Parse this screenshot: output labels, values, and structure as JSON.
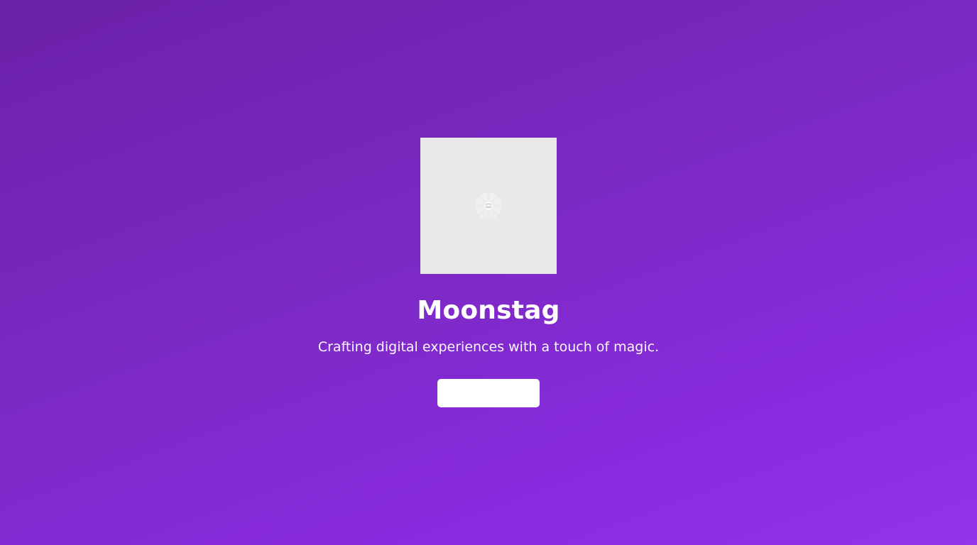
{
  "brand": {
    "name": "Moonstag",
    "tagline": "Crafting digital experiences with a touch of magic."
  },
  "hero_image": {
    "icon": "image-placeholder-icon"
  },
  "cta": {
    "label": ""
  },
  "colors": {
    "gradient_start": "#6b21a8",
    "gradient_end": "#9333ea",
    "image_placeholder_bg": "#e9e9ea",
    "button_bg": "#ffffff",
    "text": "#ffffff"
  }
}
